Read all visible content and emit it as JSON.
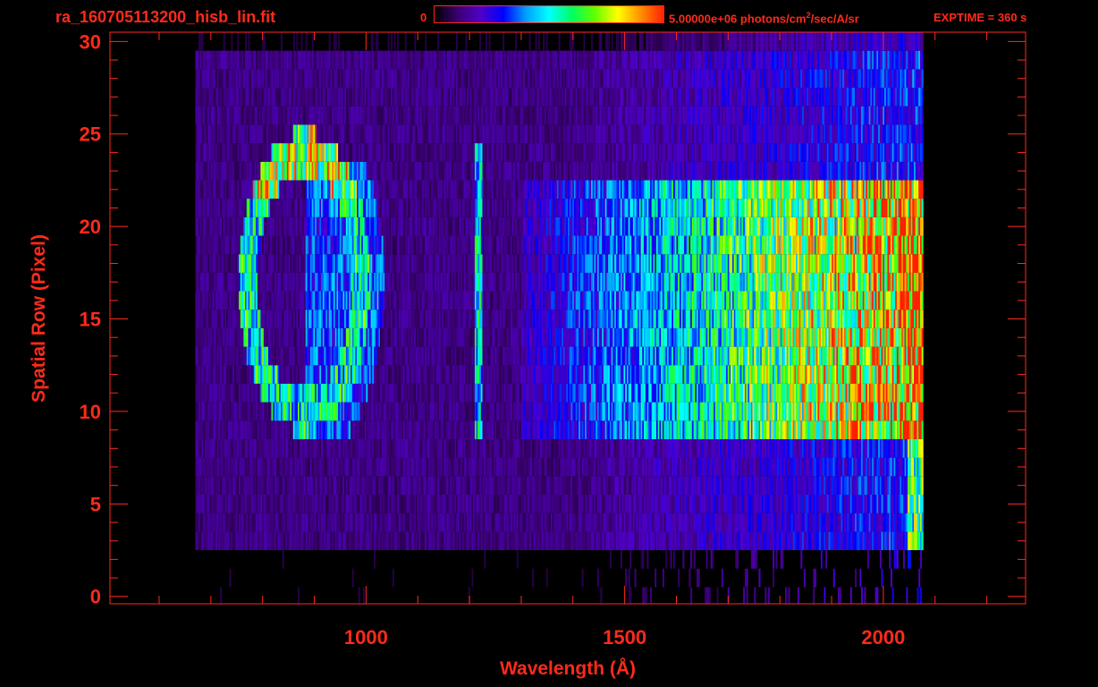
{
  "header": {
    "filename": "ra_160705113200_hisb_lin.fit",
    "colorbar_min": "0",
    "colorbar_max_prefix": "5.00000e+06 photons/cm",
    "colorbar_max_sup": "2",
    "colorbar_max_suffix": "/sec/A/sr",
    "exptime": "EXPTIME = 360 s"
  },
  "colors": {
    "axis": "#ff2a1a",
    "background": "#000000",
    "colormap": [
      "#000000",
      "#3a0070",
      "#5000c8",
      "#0000ff",
      "#00a0ff",
      "#00ffff",
      "#00ff60",
      "#60ff00",
      "#ffff00",
      "#ff9000",
      "#ff2000"
    ]
  },
  "chart_data": {
    "type": "heatmap",
    "xlabel": "Wavelength (Å)",
    "ylabel": "Spatial Row (Pixel)",
    "xlim": [
      505,
      2275
    ],
    "ylim": [
      -0.4,
      30.5
    ],
    "x_ticks": [
      1000,
      1500,
      2000
    ],
    "y_ticks": [
      0,
      5,
      10,
      15,
      20,
      25,
      30
    ],
    "grid": false,
    "colorbar": {
      "min": 0,
      "max": 5000000,
      "units": "photons/cm2/sec/A/sr"
    },
    "rows": [
      0,
      30
    ],
    "wavelength_range": [
      670,
      2075
    ],
    "features": [
      {
        "kind": "ring",
        "center_x": 880,
        "center_y": 17,
        "radius_x": 110,
        "radius_y": 7,
        "level": 0.55
      },
      {
        "kind": "vertical_line",
        "x": 1216,
        "rows": [
          9,
          24
        ],
        "level": 0.5
      },
      {
        "kind": "continuum",
        "x_range": [
          1500,
          2070
        ],
        "rows": [
          9,
          22
        ],
        "peak_level": 0.75
      }
    ]
  }
}
